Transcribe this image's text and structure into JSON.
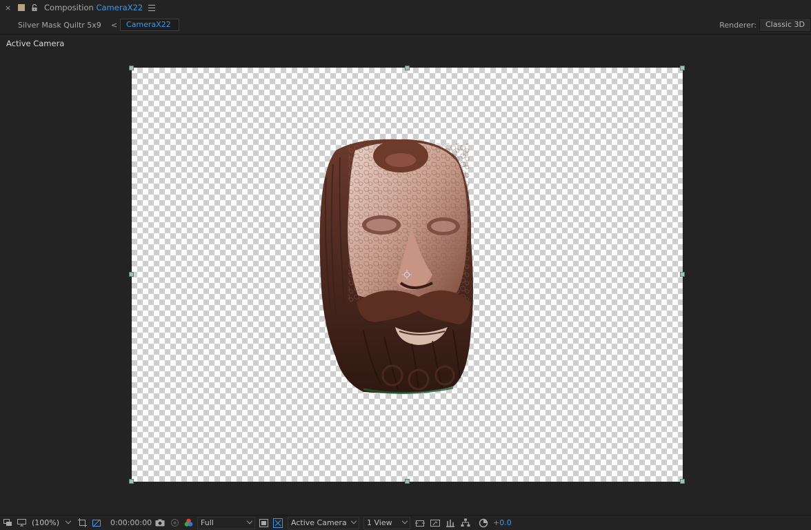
{
  "panel": {
    "close_glyph": "×",
    "title_prefix": "Composition",
    "comp_name": "CameraX22"
  },
  "breadcrumb": {
    "items": [
      {
        "label": "Silver Mask Quiltr 5x9"
      },
      {
        "label": "CameraX22"
      }
    ],
    "separator": "<"
  },
  "renderer": {
    "label": "Renderer:",
    "value": "Classic 3D"
  },
  "viewer": {
    "view_label": "Active Camera"
  },
  "toolbar": {
    "magnification": "(100%)",
    "timecode": "0:00:00:00",
    "resolution": "Full",
    "camera": "Active Camera",
    "views": "1 View",
    "exposure": "+0.0"
  },
  "colors": {
    "accent": "#3a9bf0",
    "label_swatch": "#b5a584",
    "handle": "#9fc3b8",
    "background": "#232323"
  },
  "icons": [
    "close-icon",
    "lock-icon",
    "panel-menu-icon",
    "always-preview-icon",
    "monitor-icon",
    "chevron-down-icon",
    "region-of-interest-icon",
    "transparency-grid-icon",
    "snapshot-icon",
    "show-snapshot-icon",
    "color-channel-icon",
    "toggle-mask-icon",
    "fast-preview-icon",
    "comp-flowchart-icon",
    "reset-exposure-icon"
  ]
}
